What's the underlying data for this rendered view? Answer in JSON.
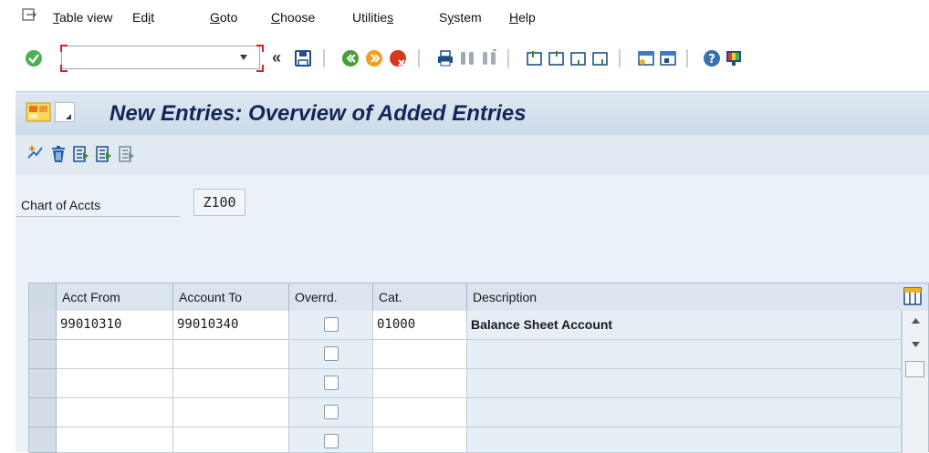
{
  "menu": {
    "items": [
      "Table view",
      "Edit",
      "Goto",
      "Choose",
      "Utilities",
      "System",
      "Help"
    ],
    "underlines": [
      "T",
      "i",
      "G",
      "C",
      "s",
      "y",
      "H"
    ]
  },
  "toolbar": {
    "command_value": "",
    "command_placeholder": "",
    "more_glyph": "«"
  },
  "title": {
    "text": "New Entries: Overview of Added Entries"
  },
  "form": {
    "chart_of_accts_label": "Chart of Accts",
    "chart_of_accts_value": "Z100"
  },
  "table": {
    "columns": [
      "Acct From",
      "Account To",
      "Overrd.",
      "Cat.",
      "Description"
    ],
    "rows": [
      {
        "acct_from": "99010310",
        "account_to": "99010340",
        "overrd": false,
        "cat": "01000",
        "description": "Balance Sheet Account"
      },
      {
        "acct_from": "",
        "account_to": "",
        "overrd": false,
        "cat": "",
        "description": ""
      },
      {
        "acct_from": "",
        "account_to": "",
        "overrd": false,
        "cat": "",
        "description": ""
      },
      {
        "acct_from": "",
        "account_to": "",
        "overrd": false,
        "cat": "",
        "description": ""
      },
      {
        "acct_from": "",
        "account_to": "",
        "overrd": false,
        "cat": "",
        "description": ""
      }
    ]
  },
  "colors": {
    "title_text": "#13265a",
    "accent_green": "#4caf50",
    "accent_orange": "#f0a020",
    "accent_red": "#d32020"
  }
}
